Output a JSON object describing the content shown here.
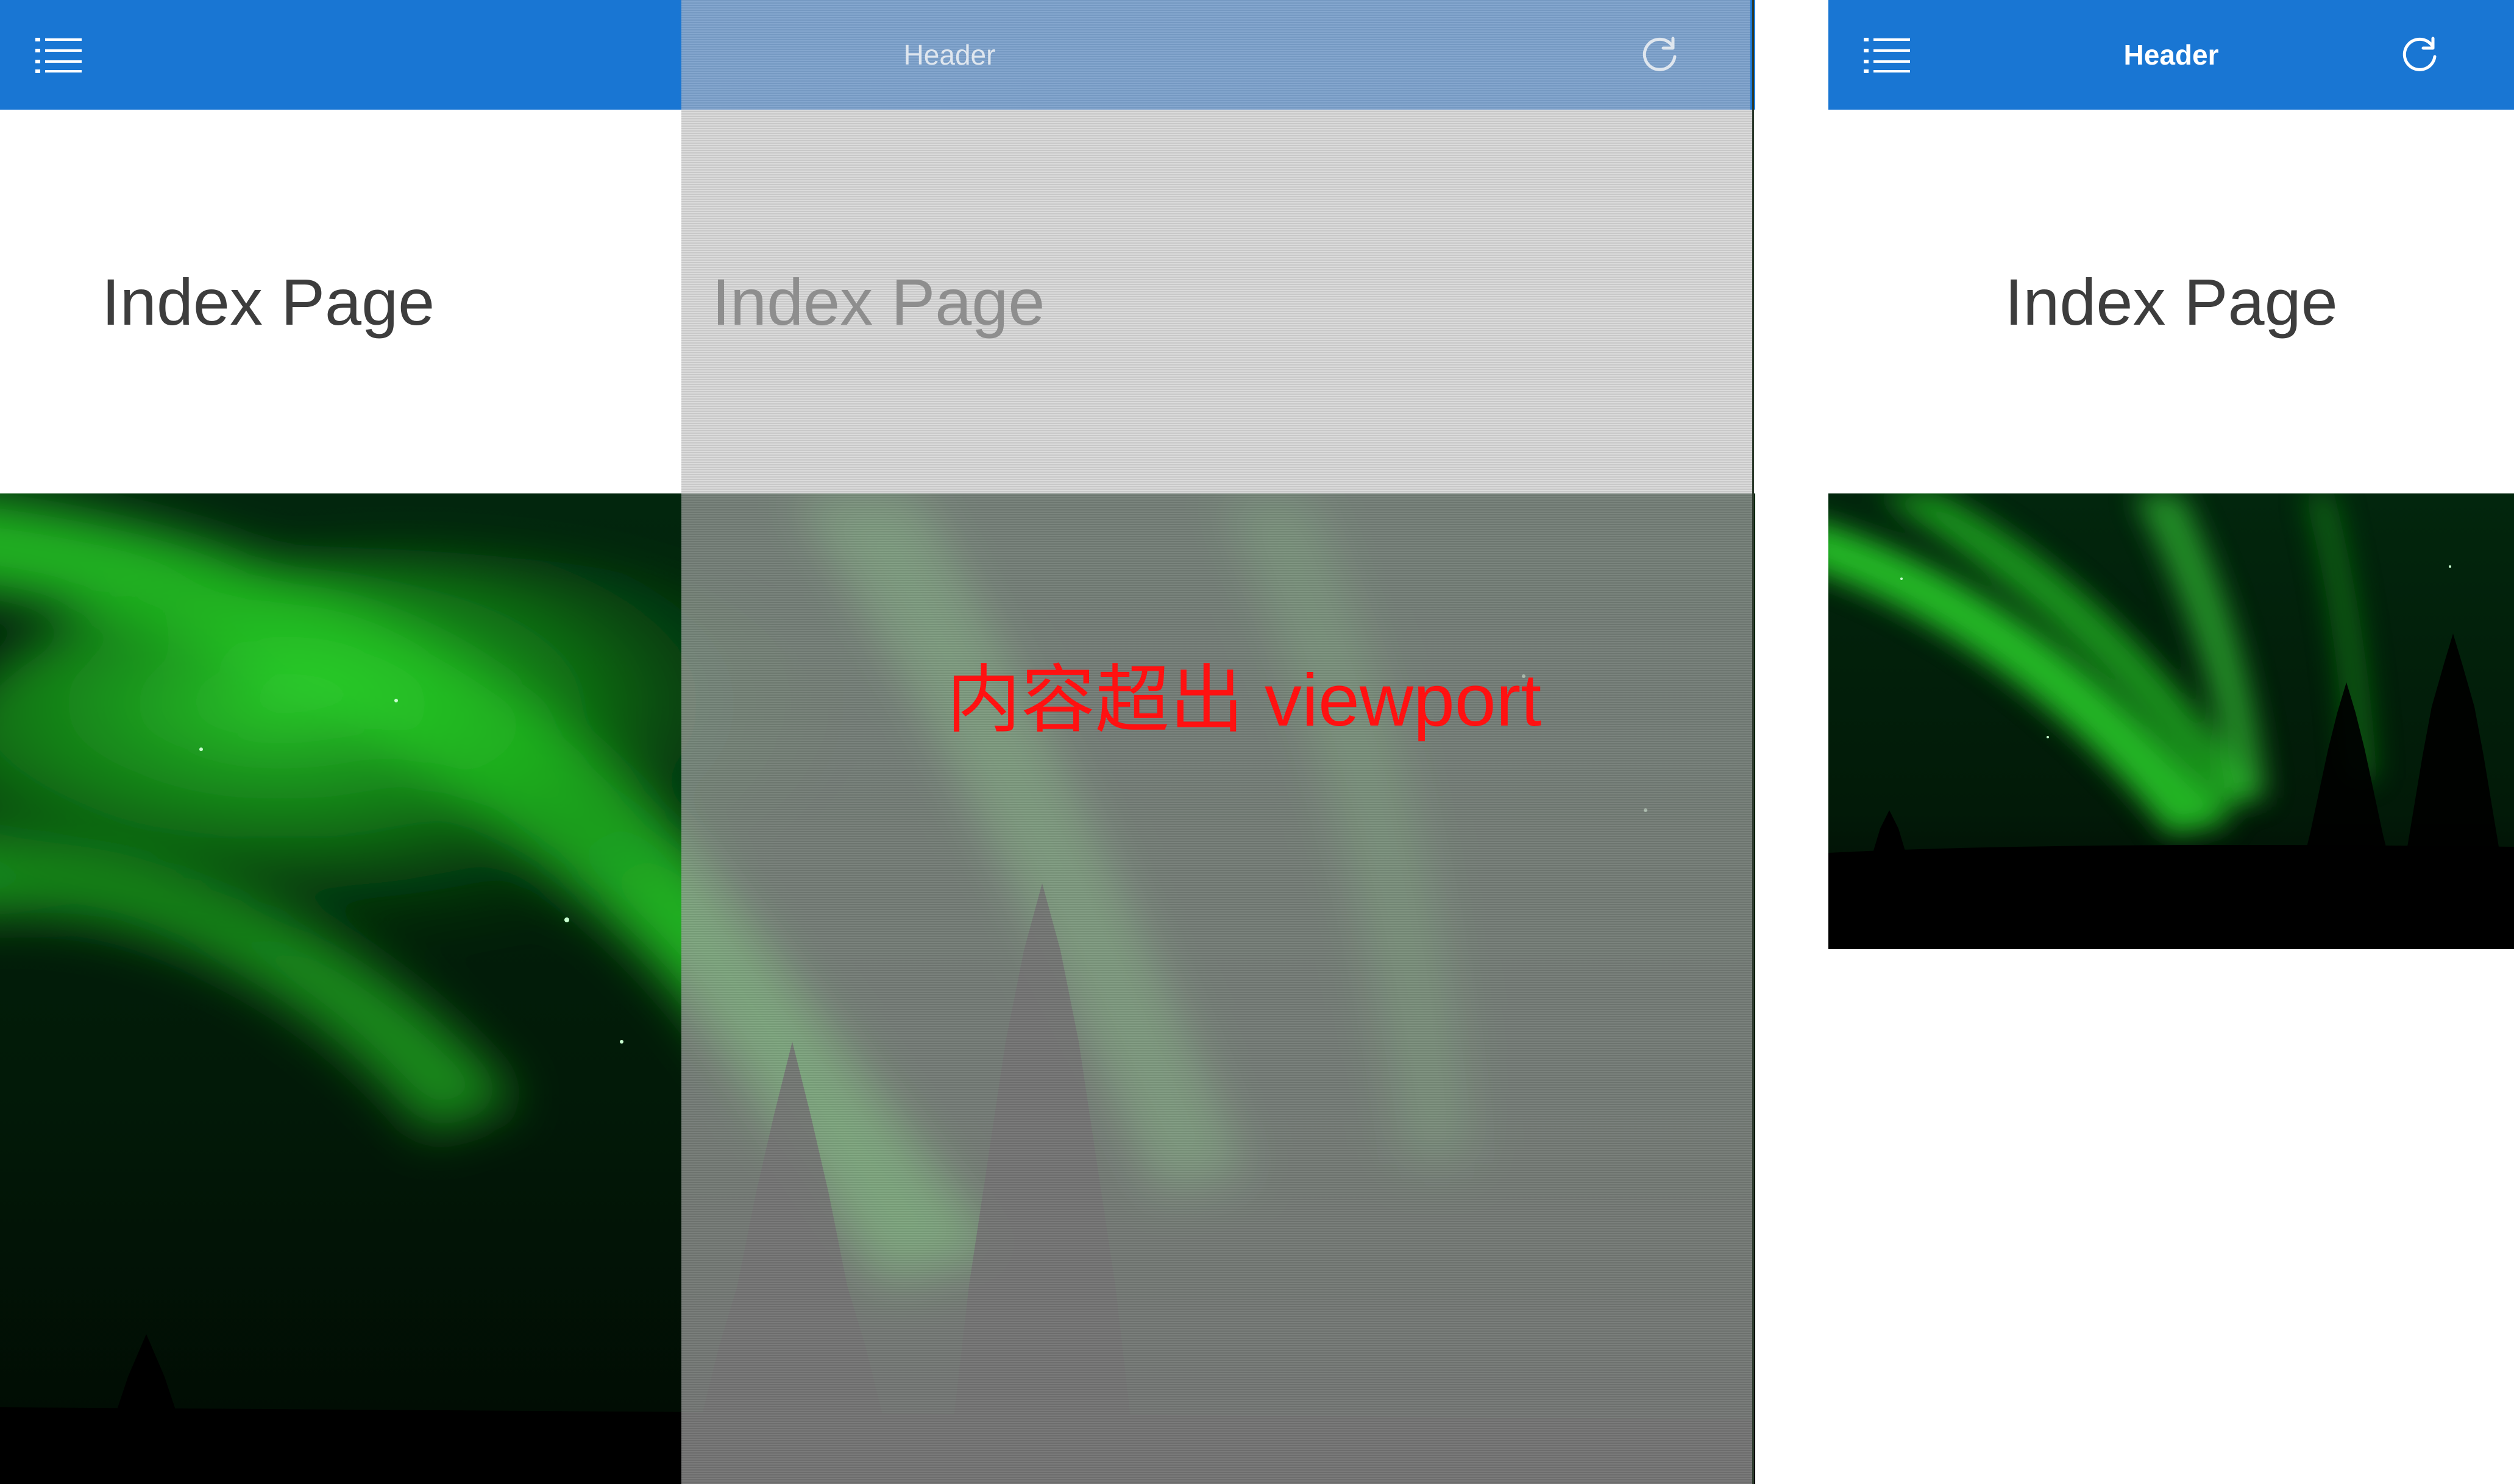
{
  "header": {
    "title": "Header",
    "menu_icon": "list-icon",
    "refresh_icon": "refresh-icon"
  },
  "page": {
    "title": "Index Page"
  },
  "hero_image": {
    "subject": "aurora-night-trees",
    "icon": "aurora-image"
  },
  "annotation": {
    "text": "内容超出 viewport"
  },
  "colors": {
    "header_bg": "#1976d3",
    "annotation": "#ff1111",
    "aurora": "#22d622",
    "sky": "#021a08"
  }
}
